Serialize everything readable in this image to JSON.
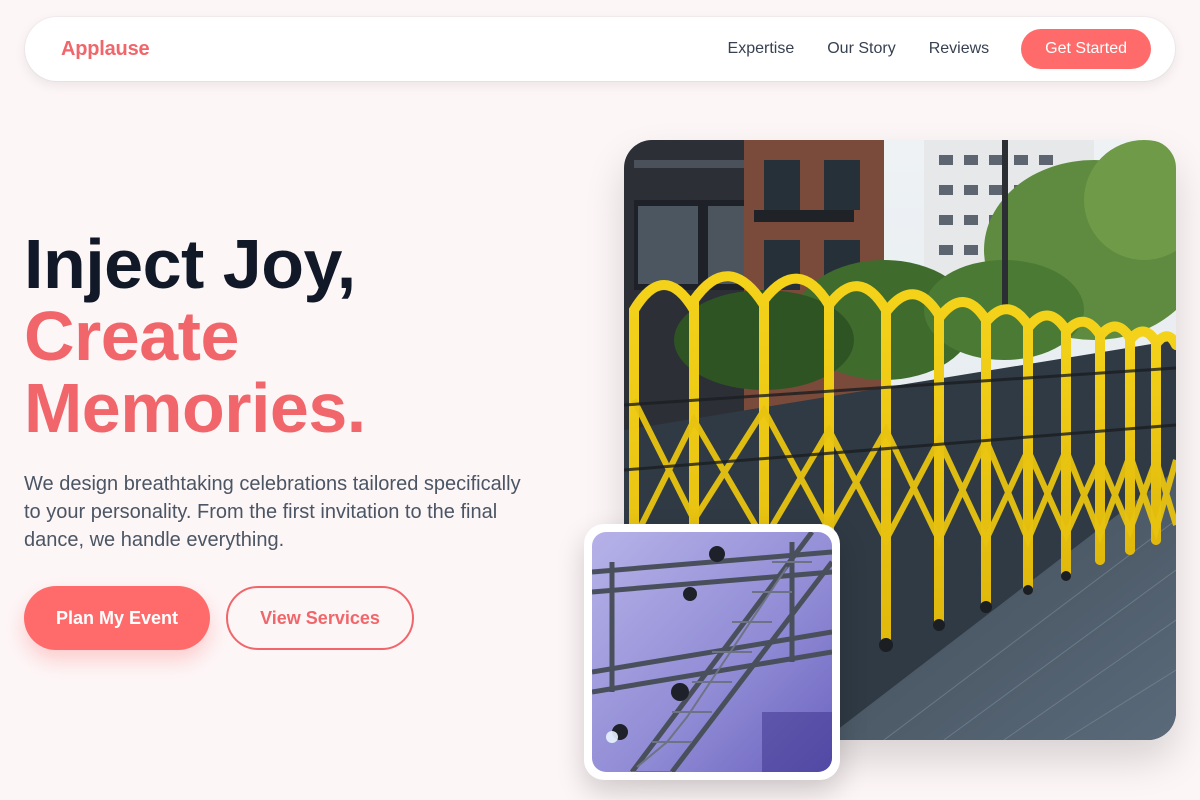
{
  "nav": {
    "brand": "Applause",
    "links": [
      "Expertise",
      "Our Story",
      "Reviews"
    ],
    "cta": "Get Started"
  },
  "hero": {
    "headline_line1": "Inject Joy,",
    "headline_line2": "Create",
    "headline_line3": "Memories.",
    "subtext": "We design breathtaking celebrations tailored specifically to your personality. From the first invitation to the final dance, we handle everything.",
    "primary_button": "Plan My Event",
    "secondary_button": "View Services"
  },
  "images": {
    "main": "photo of yellow folding barrier gates on a city sidewalk with buildings and trees",
    "inset": "photo of stage lighting truss rig with spotlights under purple light"
  },
  "colors": {
    "accent": "#ff6b6b",
    "accent_text": "#f0666a",
    "heading": "#111827",
    "body": "#4b5563",
    "background": "#fdf6f7"
  }
}
